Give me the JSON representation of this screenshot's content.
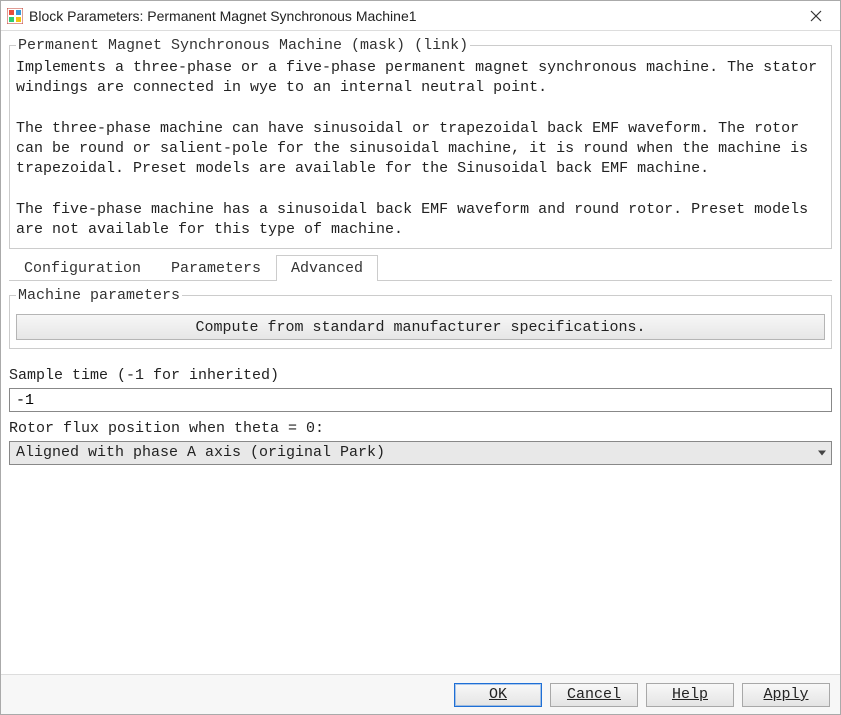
{
  "window": {
    "title": "Block Parameters: Permanent Magnet Synchronous Machine1"
  },
  "mask": {
    "legend": "Permanent Magnet Synchronous Machine (mask) (link)",
    "description": "Implements a three-phase or a five-phase permanent magnet synchronous machine. The stator windings are connected in wye to an internal neutral point.\n\nThe three-phase machine can have sinusoidal or trapezoidal back EMF waveform. The rotor can be round or salient-pole for the sinusoidal machine, it is round when the machine is trapezoidal. Preset models are available for the Sinusoidal back EMF machine.\n\nThe five-phase machine has a sinusoidal back EMF waveform and round rotor. Preset models are not available for this type of machine."
  },
  "tabs": {
    "configuration": "Configuration",
    "parameters": "Parameters",
    "advanced": "Advanced",
    "active": "advanced"
  },
  "advanced": {
    "machine_params_legend": "Machine parameters",
    "compute_button": "Compute from standard manufacturer specifications.",
    "sample_time_label": "Sample time (-1 for inherited)",
    "sample_time_value": "-1",
    "rotor_flux_label": "Rotor flux position when theta = 0:",
    "rotor_flux_value": "Aligned with phase A axis (original Park)"
  },
  "buttons": {
    "ok": "OK",
    "cancel": "Cancel",
    "help": "Help",
    "apply": "Apply"
  }
}
